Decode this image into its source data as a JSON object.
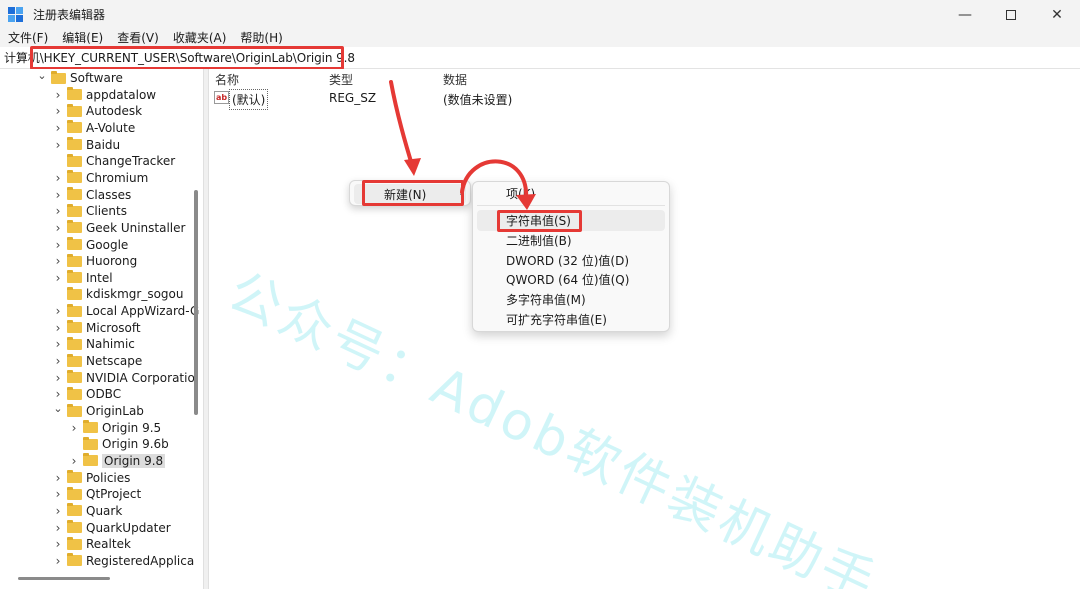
{
  "window": {
    "title": "注册表编辑器",
    "minimize": "—",
    "close": "✕"
  },
  "menu": [
    "文件(F)",
    "编辑(E)",
    "查看(V)",
    "收藏夹(A)",
    "帮助(H)"
  ],
  "address": {
    "value": "计算机\\HKEY_CURRENT_USER\\Software\\OriginLab\\Origin 9.8"
  },
  "tree": {
    "items": [
      {
        "label": "Software",
        "state": "expanded"
      },
      {
        "label": "appdatalow",
        "state": "collapsed"
      },
      {
        "label": "Autodesk",
        "state": "collapsed"
      },
      {
        "label": "A-Volute",
        "state": "collapsed"
      },
      {
        "label": "Baidu",
        "state": "collapsed"
      },
      {
        "label": "ChangeTracker",
        "state": "none"
      },
      {
        "label": "Chromium",
        "state": "collapsed"
      },
      {
        "label": "Classes",
        "state": "collapsed"
      },
      {
        "label": "Clients",
        "state": "collapsed"
      },
      {
        "label": "Geek Uninstaller",
        "state": "collapsed"
      },
      {
        "label": "Google",
        "state": "collapsed"
      },
      {
        "label": "Huorong",
        "state": "collapsed"
      },
      {
        "label": "Intel",
        "state": "collapsed"
      },
      {
        "label": "kdiskmgr_sogou",
        "state": "none"
      },
      {
        "label": "Local AppWizard-G",
        "state": "collapsed"
      },
      {
        "label": "Microsoft",
        "state": "collapsed"
      },
      {
        "label": "Nahimic",
        "state": "collapsed"
      },
      {
        "label": "Netscape",
        "state": "collapsed"
      },
      {
        "label": "NVIDIA Corporatio",
        "state": "collapsed"
      },
      {
        "label": "ODBC",
        "state": "collapsed"
      },
      {
        "label": "OriginLab",
        "state": "expanded"
      },
      {
        "label": "Origin 9.5",
        "state": "collapsed"
      },
      {
        "label": "Origin 9.6b",
        "state": "none"
      },
      {
        "label": "Origin 9.8",
        "state": "collapsed",
        "selected": true
      },
      {
        "label": "Policies",
        "state": "collapsed"
      },
      {
        "label": "QtProject",
        "state": "collapsed"
      },
      {
        "label": "Quark",
        "state": "collapsed"
      },
      {
        "label": "QuarkUpdater",
        "state": "collapsed"
      },
      {
        "label": "Realtek",
        "state": "collapsed"
      },
      {
        "label": "RegisteredApplica",
        "state": "collapsed"
      }
    ]
  },
  "list": {
    "headers": {
      "name": "名称",
      "type": "类型",
      "data": "数据"
    },
    "rows": [
      {
        "icon": "ab",
        "name": "(默认)",
        "type": "REG_SZ",
        "data": "(数值未设置)"
      }
    ]
  },
  "context_menu": {
    "new_label": "新建(N)",
    "submenu_arrow": "›"
  },
  "submenu": {
    "items": [
      "项(K)",
      "字符串值(S)",
      "二进制值(B)",
      "DWORD (32 位)值(D)",
      "QWORD (64 位)值(Q)",
      "多字符串值(M)",
      "可扩充字符串值(E)"
    ]
  },
  "watermark": "公众号：Adob软件装机助手",
  "colors": {
    "highlight_red": "#e53935",
    "folder": "#f0c246",
    "watermark": "#78e1eb"
  }
}
